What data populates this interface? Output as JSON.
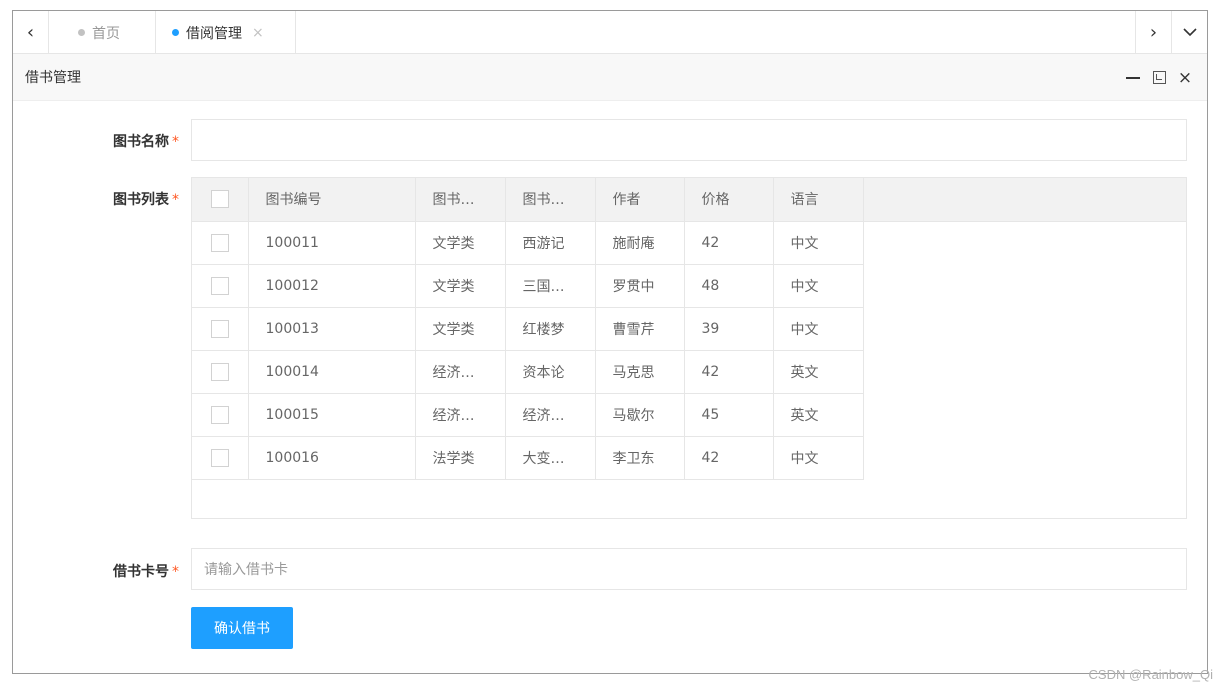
{
  "tabs": {
    "prev_icon": "‹",
    "next_icon": "›",
    "down_icon": "⌄",
    "items": [
      {
        "label": "首页",
        "active": false
      },
      {
        "label": "借阅管理",
        "active": true,
        "close": "×"
      }
    ]
  },
  "panel": {
    "title": "借书管理",
    "min_icon": "minimize-icon",
    "max_icon": "maximize-icon",
    "close_icon": "×"
  },
  "form": {
    "book_name": {
      "label": "图书名称",
      "required": "*",
      "value": ""
    },
    "book_list": {
      "label": "图书列表",
      "required": "*"
    },
    "card_no": {
      "label": "借书卡号",
      "required": "*",
      "placeholder": "请输入借书卡"
    },
    "confirm_label": "确认借书"
  },
  "table": {
    "columns": [
      "图书编号",
      "图书…",
      "图书…",
      "作者",
      "价格",
      "语言"
    ],
    "rows": [
      [
        "100011",
        "文学类",
        "西游记",
        "施耐庵",
        "42",
        "中文"
      ],
      [
        "100012",
        "文学类",
        "三国…",
        "罗贯中",
        "48",
        "中文"
      ],
      [
        "100013",
        "文学类",
        "红楼梦",
        "曹雪芹",
        "39",
        "中文"
      ],
      [
        "100014",
        "经济…",
        "资本论",
        "马克思",
        "42",
        "英文"
      ],
      [
        "100015",
        "经济…",
        "经济…",
        "马歇尔",
        "45",
        "英文"
      ],
      [
        "100016",
        "法学类",
        "大变…",
        "李卫东",
        "42",
        "中文"
      ]
    ]
  },
  "watermark": "CSDN @Rainbow_Qi",
  "colors": {
    "accent": "#1e9fff",
    "required": "#ff5722"
  }
}
